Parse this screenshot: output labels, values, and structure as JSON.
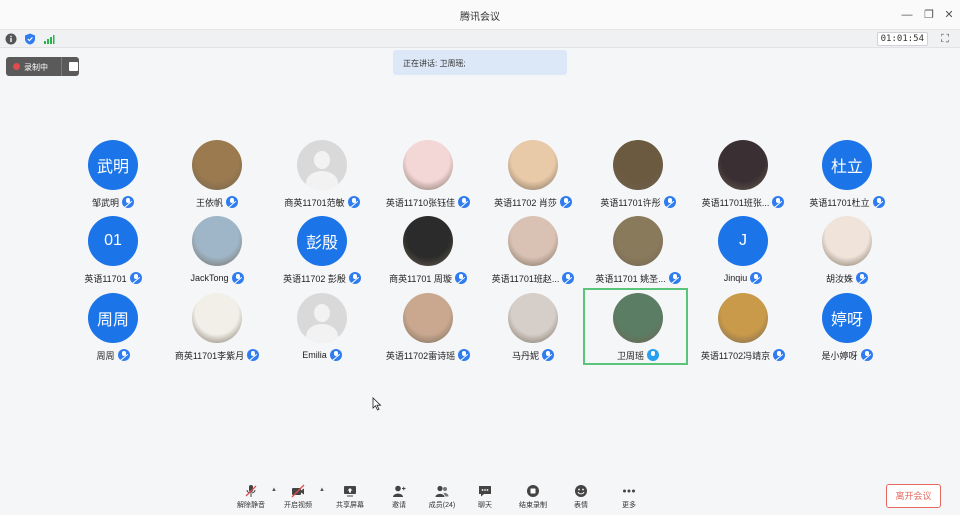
{
  "app": {
    "title": "腾讯会议"
  },
  "status": {
    "timer": "01:01:54"
  },
  "recording": {
    "label": "录制中"
  },
  "speaking": {
    "text": "正在讲话: 卫周瑶;"
  },
  "participants": [
    {
      "name": "邹武明",
      "avatar_text": "武明",
      "type": "text"
    },
    {
      "name": "王依帆",
      "type": "photo",
      "color": "#9a7a4e"
    },
    {
      "name": "商英11701范敏",
      "type": "grey"
    },
    {
      "name": "英语11710张钰佳",
      "type": "photo",
      "color": "#f3d6d6"
    },
    {
      "name": "英语11702 肖莎",
      "type": "photo",
      "color": "#e8c9a8"
    },
    {
      "name": "英语11701许彤",
      "type": "photo",
      "color": "#6b5a40"
    },
    {
      "name": "英语11701班张...",
      "type": "photo",
      "color": "#3a2f33"
    },
    {
      "name": "英语11701杜立",
      "avatar_text": "杜立",
      "type": "text"
    },
    {
      "name": "英语11701",
      "avatar_text": "01",
      "type": "text"
    },
    {
      "name": "JackTong",
      "type": "photo",
      "color": "#9fb6c8"
    },
    {
      "name": "英语11702 彭殷",
      "avatar_text": "彭殷",
      "type": "text"
    },
    {
      "name": "商英11701 周璇",
      "type": "photo",
      "color": "#2b2b2b"
    },
    {
      "name": "英语11701班赵...",
      "type": "photo",
      "color": "#d9c2b4"
    },
    {
      "name": "英语11701 姚圣...",
      "type": "photo",
      "color": "#8a7a5c"
    },
    {
      "name": "Jinqiu",
      "avatar_text": "J",
      "type": "text"
    },
    {
      "name": "胡汝姝",
      "type": "photo",
      "color": "#efe3da"
    },
    {
      "name": "周周",
      "avatar_text": "周周",
      "type": "text"
    },
    {
      "name": "商英11701李紫月",
      "type": "photo",
      "color": "#f1efe8"
    },
    {
      "name": "Emilia",
      "type": "grey"
    },
    {
      "name": "英语11702雷诗瑶",
      "type": "photo",
      "color": "#c9a88f"
    },
    {
      "name": "马丹妮",
      "type": "photo",
      "color": "#d6cfc9"
    },
    {
      "name": "卫周瑶",
      "type": "photo",
      "color": "#5b7d63",
      "speaking": true
    },
    {
      "name": "英语11702冯靖京",
      "type": "photo",
      "color": "#c99a4a"
    },
    {
      "name": "是小婷呀",
      "avatar_text": "婷呀",
      "type": "text"
    }
  ],
  "toolbar": {
    "mute": "解除静音",
    "video": "开启视频",
    "share": "共享屏幕",
    "invite": "邀请",
    "members": "成员(24)",
    "chat": "聊天",
    "end_record": "结束录制",
    "emoji": "表情",
    "more": "更多",
    "leave": "离开会议"
  }
}
